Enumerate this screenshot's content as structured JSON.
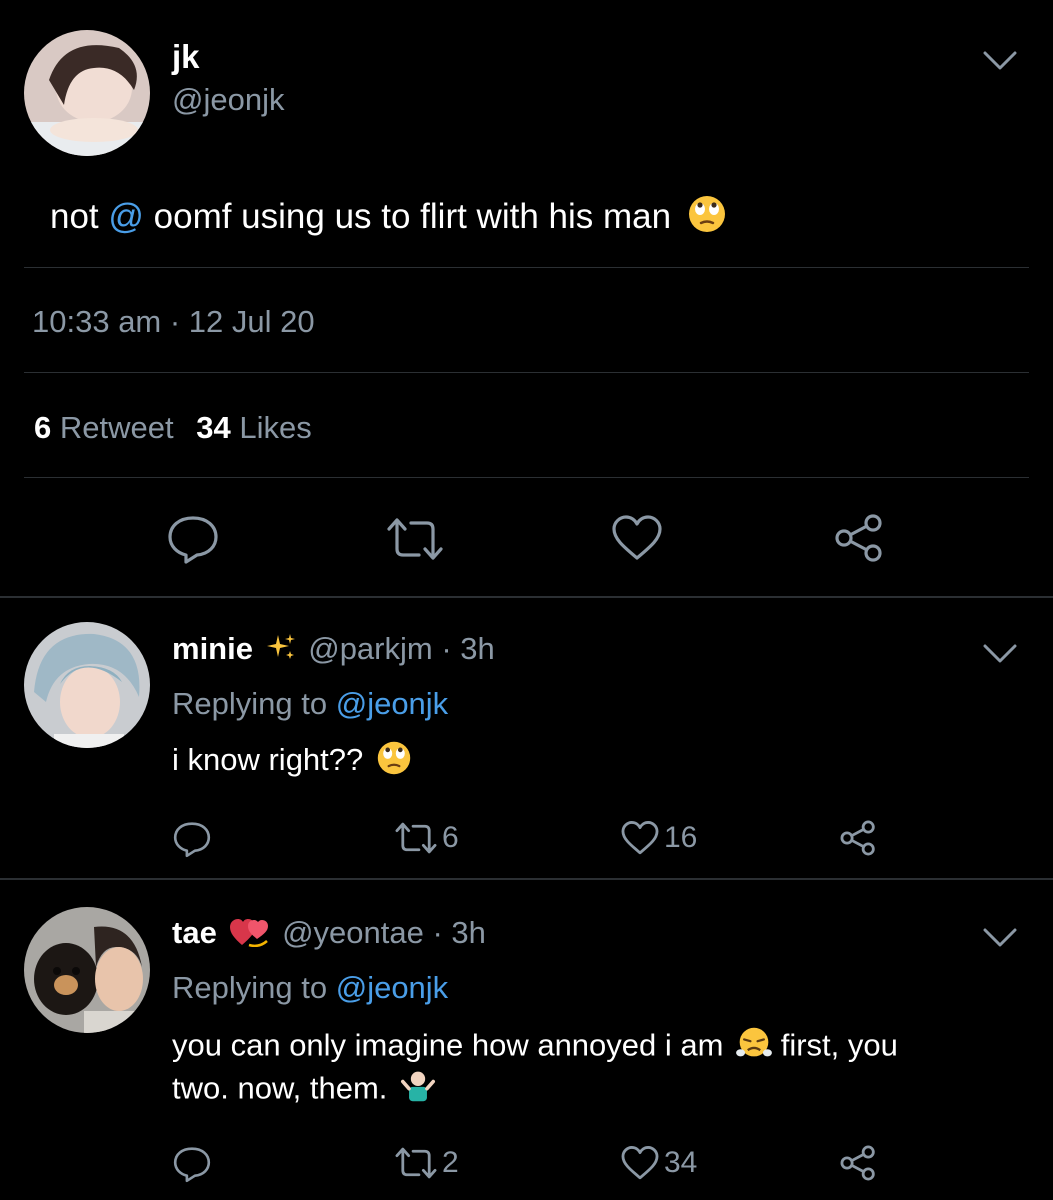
{
  "main_tweet": {
    "display_name": "jk",
    "handle": "@jeonjk",
    "text_before": "not ",
    "mention": "@",
    "text_after": " oomf using us to flirt with his man",
    "emoji": "eye-roll-emoji",
    "timestamp": "10:33 am · 12 Jul 20",
    "retweet_count": "6",
    "retweet_label": "Retweet",
    "like_count": "34",
    "like_label": "Likes"
  },
  "replies": [
    {
      "display_name": "minie",
      "name_emoji": "sparkles-emoji",
      "handle": "@parkjm",
      "age": "· 3h",
      "replying_label": "Replying to",
      "replying_to": "@jeonjk",
      "text": "i know right??",
      "text_emoji": "eye-roll-emoji",
      "retweets": "6",
      "likes": "16"
    },
    {
      "display_name": "tae",
      "name_emoji": "heart-exclamation-emoji",
      "handle": "@yeontae",
      "age": "· 3h",
      "replying_label": "Replying to",
      "replying_to": "@jeonjk",
      "text_line1": "you can only imagine how annoyed i am",
      "text_line1_after": "first, you",
      "text_line2": "two. now, them.",
      "text_emoji1": "steam-face-emoji",
      "text_emoji2": "shrug-emoji",
      "retweets": "2",
      "likes": "34"
    }
  ],
  "colors": {
    "background": "#000000",
    "link": "#4a9ee8",
    "muted": "#8b98a5",
    "divider": "#2b2f33"
  }
}
